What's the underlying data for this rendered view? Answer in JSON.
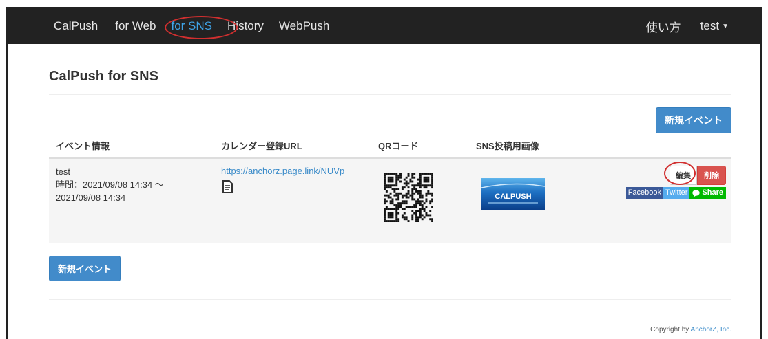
{
  "nav": {
    "brand": "CalPush",
    "items": [
      "for Web",
      "for SNS",
      "History",
      "WebPush"
    ],
    "active_index": 1,
    "help": "使い方",
    "user": "test",
    "accent_color": "#3fa4e8"
  },
  "page": {
    "title": "CalPush for SNS",
    "new_event_label": "新規イベント"
  },
  "table": {
    "headers": [
      "イベント情報",
      "カレンダー登録URL",
      "QRコード",
      "SNS投稿用画像",
      ""
    ],
    "rows": [
      {
        "name": "test",
        "time_line1": "時間：2021/09/08 14:34 ～",
        "time_line2": "2021/09/08 14:34",
        "url": "https://anchorz.page.link/NUVp",
        "copy_icon": "copy-document-icon",
        "sns_image_text": "CALPUSH",
        "edit_label": "編集",
        "delete_label": "削除",
        "share": {
          "facebook": "Facebook",
          "twitter": "Twitter",
          "line": "Share"
        }
      }
    ]
  },
  "footer": {
    "prefix": "Copyright by ",
    "company": "AnchorZ, Inc."
  }
}
